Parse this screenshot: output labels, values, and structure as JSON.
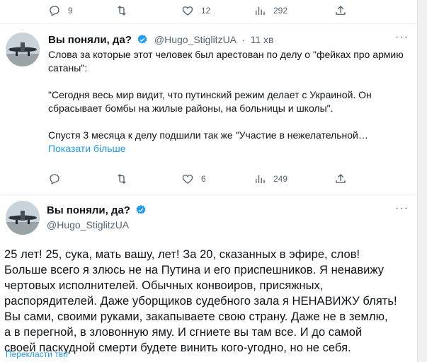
{
  "top_actions": {
    "reply_count": "9",
    "retweet_count": "",
    "like_count": "12",
    "views_count": "292"
  },
  "tweet1": {
    "display_name": "Вы поняли, да?",
    "handle": "@Hugo_StiglitzUA",
    "separator": "·",
    "time": "11 хв",
    "paragraphs": [
      "Слова за которые этот человек был арестован по делу о \"фейках про армию сатаны\":",
      "\"Сегодня весь мир видит, что путинский режим делает с Украиной. Он сбрасывает бомбы на жилые районы, на больницы и школы\".",
      "Спустя 3 месяца к делу подшили так же \"Участие в нежелательной…"
    ],
    "show_more": "Показати більше",
    "actions": {
      "reply_count": "",
      "retweet_count": "",
      "like_count": "6",
      "views_count": "249"
    }
  },
  "tweet2": {
    "display_name": "Вы поняли, да?",
    "handle": "@Hugo_StiglitzUA",
    "lines": [
      "25 лет! 25, сука, мать вашу, лет! За 20, сказанных в эфире, слов!",
      "Больше всего я злюсь не на Путина и его приспешников. Я ненавижу",
      "чертовых исполнителей. Обычных конвоиров, присяжных,",
      "распорядителей. Даже уборщиков судебного зала я НЕНАВИЖУ блять!",
      "Вы сами, своими руками, закапываете свою страну. Даже не в землю,",
      "а в перегной, в зловонную яму. И сгниете вы там все. И до самой",
      "своей паскудной смерти будете винить кого-угодно, но не себя."
    ],
    "translate": "Перекласти твіт"
  },
  "colors": {
    "accent": "#1d9bf0",
    "muted": "#536471",
    "text": "#0f1419"
  }
}
